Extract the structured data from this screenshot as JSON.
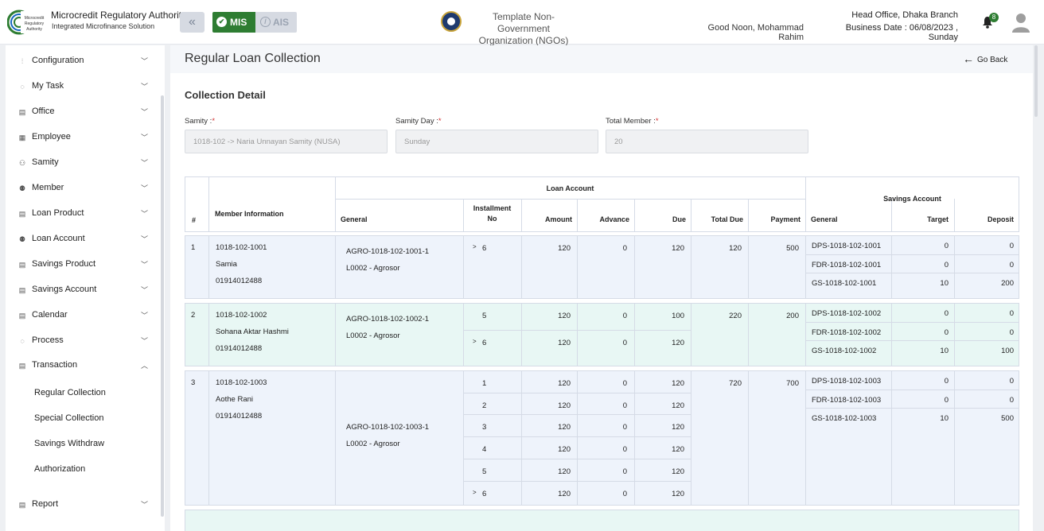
{
  "header": {
    "brand_title": "Microcredit Regulatory Authority",
    "brand_sub": "Integrated Microfinance Solution",
    "logo_text": "Microcredit Regulatory Authority",
    "mode_mis": "MIS",
    "mode_ais": "AIS",
    "org_line1": "Template Non-Government",
    "org_line2": "Organization (NGOs)",
    "greeting": "Good Noon, Mohammad Rahim",
    "branch": "Head Office, Dhaka Branch",
    "business_date": "Business Date : 06/08/2023 , Sunday",
    "notification_count": "8"
  },
  "sidebar": {
    "items": [
      {
        "label": "Configuration",
        "icon": "sliders-icon"
      },
      {
        "label": "My Task",
        "icon": "task-icon"
      },
      {
        "label": "Office",
        "icon": "office-icon"
      },
      {
        "label": "Employee",
        "icon": "employee-icon"
      },
      {
        "label": "Samity",
        "icon": "samity-icon"
      },
      {
        "label": "Member",
        "icon": "member-icon"
      },
      {
        "label": "Loan Product",
        "icon": "loan-product-icon"
      },
      {
        "label": "Loan Account",
        "icon": "loan-account-icon"
      },
      {
        "label": "Savings Product",
        "icon": "savings-product-icon"
      },
      {
        "label": "Savings Account",
        "icon": "savings-account-icon"
      },
      {
        "label": "Calendar",
        "icon": "calendar-icon"
      },
      {
        "label": "Process",
        "icon": "process-icon"
      },
      {
        "label": "Transaction",
        "icon": "transaction-icon"
      }
    ],
    "sub_items": [
      "Regular Collection",
      "Special Collection",
      "Savings Withdraw",
      "Authorization"
    ],
    "report": {
      "label": "Report",
      "icon": "report-icon"
    }
  },
  "page": {
    "title": "Regular Loan Collection",
    "go_back": "Go Back",
    "section_title": "Collection Detail",
    "fields": {
      "samity_label": "Samity :",
      "samity_value": "1018-102 -> Naria Unnayan Samity (NUSA)",
      "day_label": "Samity Day :",
      "day_value": "Sunday",
      "total_label": "Total Member :",
      "total_value": "20",
      "required_mark": "*"
    }
  },
  "table": {
    "headers": {
      "num": "#",
      "member_info": "Member Information",
      "loan_account": "Loan Account",
      "general": "General",
      "installment": "Installment",
      "installment_no": "No",
      "amount": "Amount",
      "advance": "Advance",
      "due": "Due",
      "total_due": "Total Due",
      "payment": "Payment",
      "savings_account": "Savings Account",
      "savings_general": "General",
      "target": "Target",
      "deposit": "Deposit"
    },
    "rows": [
      {
        "num": "1",
        "member_id": "1018-102-1001",
        "name": "Samia",
        "phone": "01914012488",
        "loan_account": "AGRO-1018-102-1001-1",
        "product": "L0002 - Agrosor",
        "total_due": "120",
        "payment": "500",
        "installments": [
          {
            "no": "6",
            "current": true,
            "amount": "120",
            "advance": "0",
            "due": "120"
          }
        ],
        "savings": [
          {
            "account": "DPS-1018-102-1001",
            "target": "0",
            "deposit": "0"
          },
          {
            "account": "FDR-1018-102-1001",
            "target": "0",
            "deposit": "0"
          },
          {
            "account": "GS-1018-102-1001",
            "target": "10",
            "deposit": "200"
          }
        ]
      },
      {
        "num": "2",
        "member_id": "1018-102-1002",
        "name": "Sohana Aktar Hashmi",
        "phone": "01914012488",
        "loan_account": "AGRO-1018-102-1002-1",
        "product": "L0002 - Agrosor",
        "total_due": "220",
        "payment": "200",
        "installments": [
          {
            "no": "5",
            "current": false,
            "amount": "120",
            "advance": "0",
            "due": "100"
          },
          {
            "no": "6",
            "current": true,
            "amount": "120",
            "advance": "0",
            "due": "120"
          }
        ],
        "savings": [
          {
            "account": "DPS-1018-102-1002",
            "target": "0",
            "deposit": "0"
          },
          {
            "account": "FDR-1018-102-1002",
            "target": "0",
            "deposit": "0"
          },
          {
            "account": "GS-1018-102-1002",
            "target": "10",
            "deposit": "100"
          }
        ]
      },
      {
        "num": "3",
        "member_id": "1018-102-1003",
        "name": "Aothe Rani",
        "phone": "01914012488",
        "loan_account": "AGRO-1018-102-1003-1",
        "product": "L0002 - Agrosor",
        "total_due": "720",
        "payment": "700",
        "installments": [
          {
            "no": "1",
            "current": false,
            "amount": "120",
            "advance": "0",
            "due": "120"
          },
          {
            "no": "2",
            "current": false,
            "amount": "120",
            "advance": "0",
            "due": "120"
          },
          {
            "no": "3",
            "current": false,
            "amount": "120",
            "advance": "0",
            "due": "120"
          },
          {
            "no": "4",
            "current": false,
            "amount": "120",
            "advance": "0",
            "due": "120"
          },
          {
            "no": "5",
            "current": false,
            "amount": "120",
            "advance": "0",
            "due": "120"
          },
          {
            "no": "6",
            "current": true,
            "amount": "120",
            "advance": "0",
            "due": "120"
          }
        ],
        "savings": [
          {
            "account": "DPS-1018-102-1003",
            "target": "0",
            "deposit": "0"
          },
          {
            "account": "FDR-1018-102-1003",
            "target": "0",
            "deposit": "0"
          },
          {
            "account": "GS-1018-102-1003",
            "target": "10",
            "deposit": "500"
          }
        ]
      }
    ]
  },
  "colors": {
    "brand_green": "#2e7d32",
    "row_blue": "#eef3fb",
    "row_mint": "#e8f7f4",
    "required": "#d32f2f"
  }
}
